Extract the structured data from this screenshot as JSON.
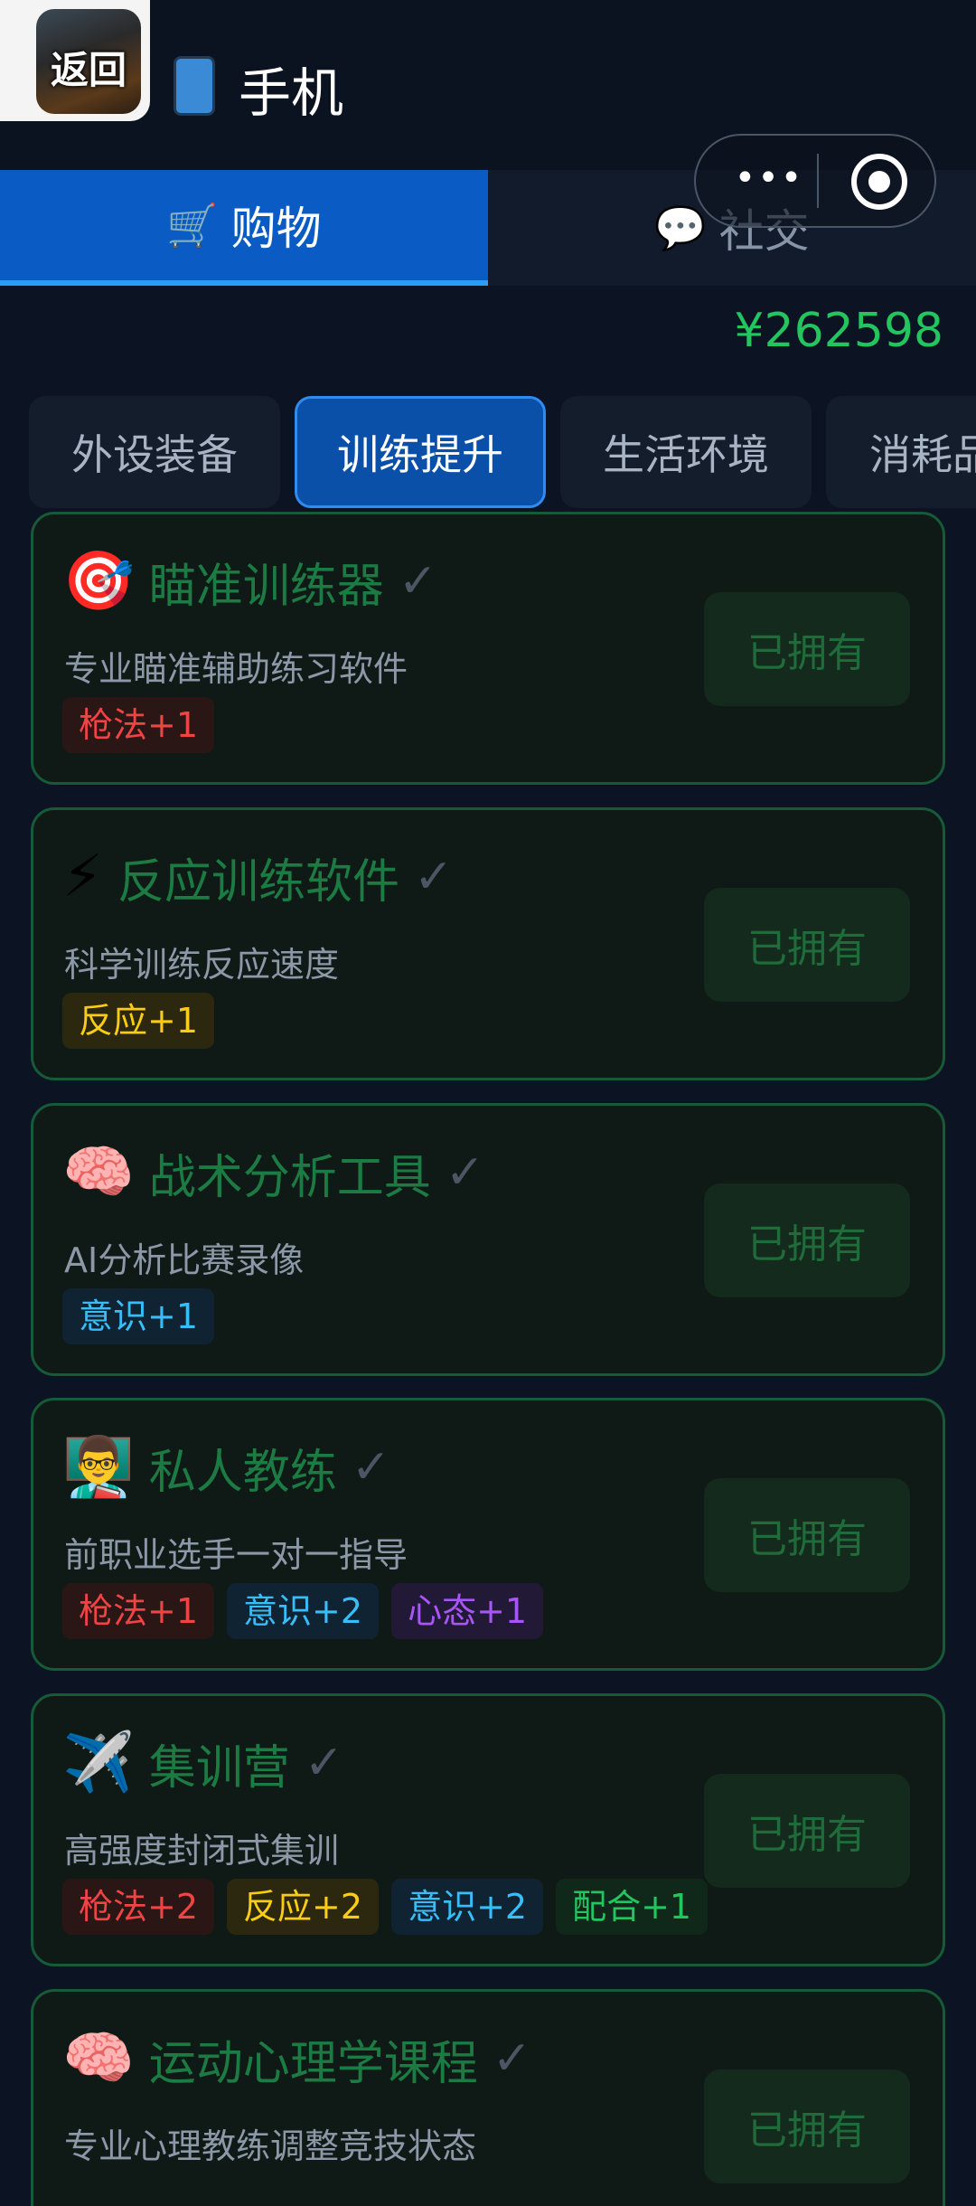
{
  "header": {
    "back_label": "返回",
    "title": "手机"
  },
  "capsule": {
    "more": "•••"
  },
  "tabs": [
    {
      "icon": "🛒",
      "label": "购物"
    },
    {
      "icon": "💬",
      "label": "社交"
    }
  ],
  "balance": "¥262598",
  "categories": [
    "外设装备",
    "训练提升",
    "生活环境",
    "消耗品"
  ],
  "items": [
    {
      "emoji": "🎯",
      "name": "瞄准训练器",
      "desc": "专业瞄准辅助练习软件",
      "tags": [
        {
          "text": "枪法+1"
        }
      ],
      "button": "已拥有"
    },
    {
      "emoji": "⚡",
      "name": "反应训练软件",
      "desc": "科学训练反应速度",
      "tags": [
        {
          "text": "反应+1"
        }
      ],
      "button": "已拥有"
    },
    {
      "emoji": "🧠",
      "name": "战术分析工具",
      "desc": "AI分析比赛录像",
      "tags": [
        {
          "text": "意识+1"
        }
      ],
      "button": "已拥有"
    },
    {
      "emoji": "👨‍🏫",
      "name": "私人教练",
      "desc": "前职业选手一对一指导",
      "tags": [
        {
          "text": "枪法+1"
        },
        {
          "text": "意识+2"
        },
        {
          "text": "心态+1"
        }
      ],
      "button": "已拥有"
    },
    {
      "emoji": "✈️",
      "name": "集训营",
      "desc": "高强度封闭式集训",
      "tags": [
        {
          "text": "枪法+2"
        },
        {
          "text": "反应+2"
        },
        {
          "text": "意识+2"
        },
        {
          "text": "配合+1"
        }
      ],
      "button": "已拥有"
    },
    {
      "emoji": "🧠",
      "name": "运动心理学课程",
      "desc": "专业心理教练调整竞技状态",
      "tags": [],
      "button": "已拥有"
    }
  ],
  "colors": {
    "accent": "#0a5cc4",
    "owned_text": "#1c7a43",
    "balance": "#22c55e"
  }
}
